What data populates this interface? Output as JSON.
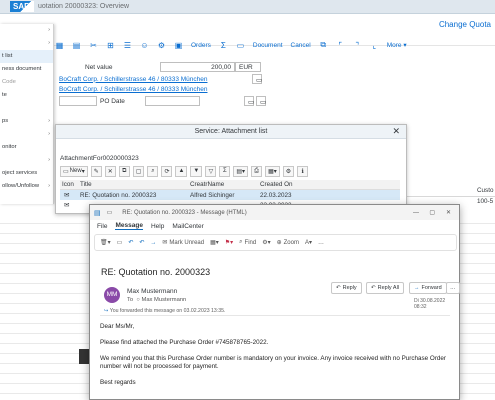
{
  "sap": {
    "window_title": "uotation 20000323: Overview",
    "header_action": "Change Quota",
    "logo": "SAP",
    "toolbar": {
      "orders": "Orders",
      "document": "Document",
      "cancel": "Cancel",
      "more": "More"
    },
    "net_value_label": "Net value",
    "net_value": "200,00",
    "currency": "EUR",
    "party1": "BoCraft Corp. / Schillerstrasse 46 / 80333 München",
    "party2": "BoCraft Corp. / Schillerstrasse 46 / 80333 München",
    "po_date_label": "PO Date",
    "left_menu": [
      {
        "label": "",
        "arrow": "›"
      },
      {
        "label": "",
        "arrow": "›"
      },
      {
        "label": "t list",
        "arrow": ""
      },
      {
        "label": "ness document",
        "arrow": ""
      },
      {
        "label": "Code",
        "arrow": "",
        "grey": true
      },
      {
        "label": "te",
        "arrow": ""
      },
      {
        "label": "",
        "arrow": ""
      },
      {
        "label": "ps",
        "arrow": "›"
      },
      {
        "label": "",
        "arrow": "›"
      },
      {
        "label": "onitor",
        "arrow": ""
      },
      {
        "label": "",
        "arrow": "›"
      },
      {
        "label": "oject services",
        "arrow": ""
      },
      {
        "label": "ollow/Unfollow",
        "arrow": "›"
      }
    ],
    "right_col_header": "Custo",
    "right_col_value": "100-5"
  },
  "attachment": {
    "title": "Service: Attachment list",
    "close_icon": "✕",
    "subtitle": "AttachmentFor0020000323",
    "new_label": "New",
    "columns": [
      "Icon",
      "Title",
      "CreatrName",
      "Created On"
    ],
    "rows": [
      {
        "title": "RE: Quotation no. 2000323",
        "creator": "Alfred Sichinger",
        "date": "22.03.2023"
      },
      {
        "title": "",
        "creator": "",
        "date": "23.03.2023"
      }
    ]
  },
  "outlook": {
    "title": "RE: Quotation no. 2000323 - Message (HTML)",
    "menu": [
      "File",
      "Message",
      "Help",
      "MailCenter"
    ],
    "ribbon": {
      "mark_unread": "Mark Unread",
      "find": "Find",
      "zoom": "Zoom"
    },
    "subject": "RE: Quotation no. 2000323",
    "avatar_initials": "MM",
    "sender": "Max Mustermann",
    "to_label": "To",
    "to_value": "Max Mustermann",
    "forwarded_note": "You forwarded this message on 03.02.2023 13:35.",
    "reply": "Reply",
    "reply_all": "Reply All",
    "forward": "Forward",
    "date": "Di 30.08.2022 08:32",
    "body": {
      "greeting": "Dear Ms/Mr,",
      "p1": "Please find attached the Purchase Order #745878765-2022.",
      "p2": "We remind you that this Purchase Order number is mandatory on your invoice. Any invoice received with no Purchase Order number will not be processed for payment.",
      "closing": "Best regards"
    }
  }
}
